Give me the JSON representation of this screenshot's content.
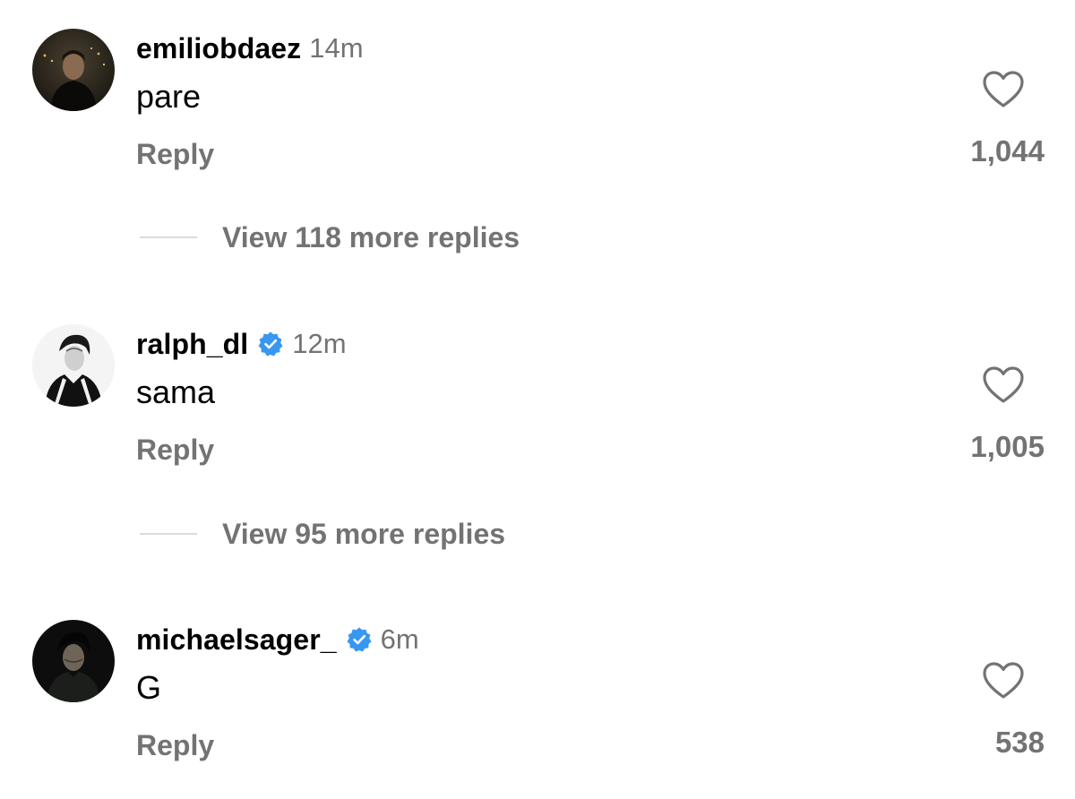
{
  "comments": [
    {
      "username": "emiliobdaez",
      "verified": false,
      "time": "14m",
      "text": "pare",
      "reply_label": "Reply",
      "likes": "1,044",
      "view_more": "View 118 more replies"
    },
    {
      "username": "ralph_dl",
      "verified": true,
      "time": "12m",
      "text": "sama",
      "reply_label": "Reply",
      "likes": "1,005",
      "view_more": "View 95 more replies"
    },
    {
      "username": "michaelsager_",
      "verified": true,
      "time": "6m",
      "text": "G",
      "reply_label": "Reply",
      "likes": "538"
    }
  ],
  "icons": {
    "like": "heart-outline-icon",
    "verified": "verified-badge-icon"
  },
  "colors": {
    "verified_blue": "#3897f0",
    "secondary_text": "#737373",
    "divider": "#dbdbdb"
  }
}
